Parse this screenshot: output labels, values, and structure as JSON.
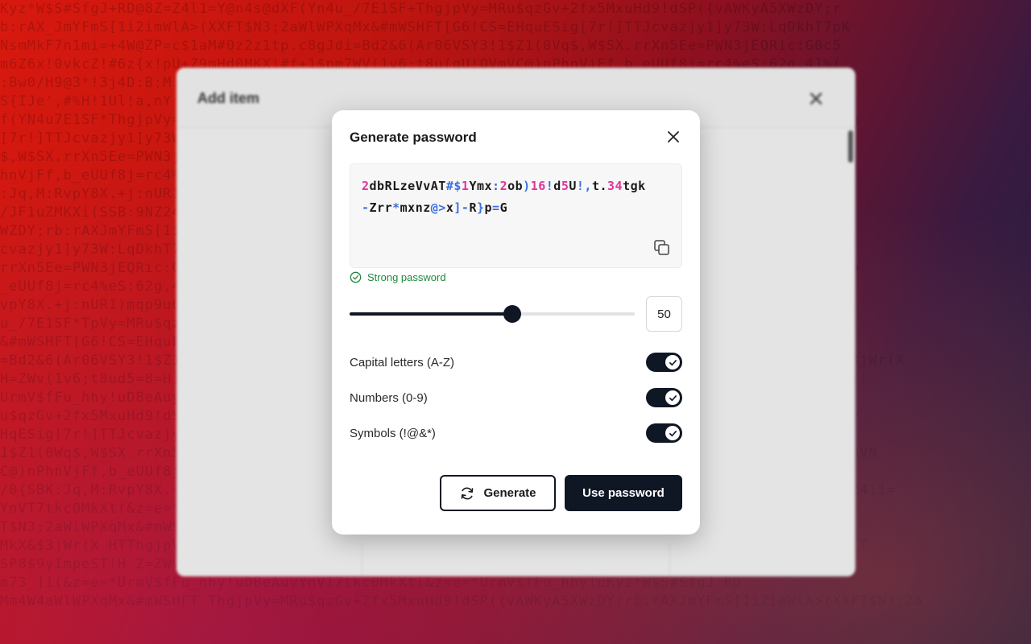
{
  "background": {
    "lines": [
      "Kyz*W$S#SfgJ+RD@8Z=Z4l1=Y@n4s@dXF(Yn4u_/7E1SF+ThgjpVy=MRu$qzGv+2fx5MxuHd9!dSP({vAWKyA5XWzDY;r",
      "b:rAX_JmYFmS[1i2imWlA>(XXFT$N3;2aWlWPXqMx&#mWSHFT[G6!CS=EHquESig[7r!]TTJcvazjy1]y73W:LqDkhT7pK",
      "NsmMkF7n1mi=+4W@ZP=c$1aM#0z2z1tp.c8gJdi=Bd2&6(Ar06VSY3!1$Z1(0Vq$,W$SX.rrXn5Ee=PWN3jEQRic:G0c5",
      "m6Z6x!0vkcZ!#6z{x!pU+Z9mHd0MKXi#f+1$pm7WV(1v6;t8u(qU!QVmVC@)nPhnVjFf,b_eUUf8j=rc4%eS:62g,4]%(",
      ":Bw0/H9@3*!3j4D:B;M.l,3x9;1Ay3:+XF!ST;W$1t(!zVu;XL!$7F5:b.9Q!!#j+B.)rsnUR1)mqp9u6&z*",
      "S{IJe',#%H!1Ul!a,nY:;2cuWOR=!p+P*M)(pU!:r$U:EnaM00p:9NZ24+WN3;L1=4!2&L6GA*TpVy=MRu$qzGv+",
      "f(YN4u7E1SF*ThgjpVy=MRu$qzGv+2fx5MxuHd9!dSP({vAWKyA5XWzDY;rb:rAXJmYFmS[1i2imWlA>[G6!CS=EHquESig",
      "[7r!]TTJcvazjy1]y73W:LqDkhT7pKNsmMkF7n1mi=+4W@ZP=c$1aM#0z2z1tp.c8gJdi=Bd2&6(Ar06VSY3!1$Z1(0Wq",
      "$,W$SX.rrXn5Ee=PWN3jEQRic:G0c5m6Z6x!0vkcZ!#6z{x!pU+Z9mHd0MKXi#f+1$pm7WV(1v6;t8ud5=8=H)oVNC@)nP",
      "hnVjFf,b_eUUf8j=rc4%eS:62g,4]%(:Bw0/H9@3*!3j4D:B;M.l,3x9;1Ay3:+XF!ST;W$1t(!zVu!U+Z9oe/0{SBK",
      ":Jq,M:RvpY8X.+j:nUR1)mqp9u6&z*S{IJe',#%H!1Ul!a,nY:;2cuWOR=!p+P*M)(pU!:r$U:EnaM0.khYfaB8+AUxrf&",
      "/JF1uZMKXi(SSB:9NZ24+WN3;L1=4!2&L6GA*TpVy=MRu$qzGv+2fx5MxuHd9!dSP({vAWKyA5XWu$qzGv+2fx5MxuM",
      "WZDY;rb:rAXJmYFmS[1i2imWlA>[G6!CS=EHquESig[7r!]TTJcvazjy1]y73W:LqDkhT7pKNsmMkF7HqESig[7r!]TTJ",
      "cvazjy1]y73W:LqDkhT7pKNsmMkF7n1mi=+4W@ZP=c$1aM#0z2z1tp.c8gJdi=Bd2&6(Ar06VSY3!1$Z1(0Wq$,W$SX.",
      "rrXn5Ee=PWN3jEQRic:G0c5m6Z6x!0vkcZ!#6z{x!pU+Z9mHd0MKXi#f+1$pm7WV(1v6;t8ud5=8=H)oVNC@)nPhnVjFf,b",
      "_eUUf8j=rc4%eS:62g,4]%(:Bw0/H9@3*!3j4D:B;M.l,3x9;1Ay3:+XF!ST;W$1t(!zVu!U+Z9oe/0{SBK:Jq,M:cR",
      "vpY8X.+j:nUR1)mqp9u6&z*S{IJe',#%H!1Ul!a,nY:;2cuWOR=!p+P*M)(pU!:r$U:EnaM0.khYfaB8+AUxrf(Yn4",
      "u_/7E1SF*TpVy=MRu$qzGv+2fx5MxuHd9!dSP({vAWKyA5XWzDY;rb:rAXJmYFmS[1i2imWlA>(XXFT$N3;2aWlWPXqMx",
      "&#mWSHFT[G6!CS=EHquESig[7r!]TTJcvazjy1]y73W:LqDkhT7pKNsmMkF7n1mi=+4W@ZP=c$1aM#0z2z1tp.c8gJdi",
      "=Bd2&6(Ar06VSY3!1$Z1(0Wq$,W$SX.rrXn5Ee=PWN3jEQRic:G0c5m6Z6x!0vkcZ!#6z{x!pU+Z9mHd0MKXi#f+1$pm3-3jWr(X",
      "H=ZWv(1v6;t8ud5=8=H)oVNC@)nPhnVjFf,b_eUUf8j=rc4%eS:62g,4]%(:Bw0/H9@3*!3j4D:B;M.l,3xSP8$9yImpeST!",
      "UrmV$fFu_hhy!uDBeAuyYnVT7tkc0MkXt(&z=e=*UrmV$fFu_hhy!uDBeAuyYnVT7tkc0MkXm73_]i(&z=e=*",
      "u$qzGv+2fx5MxuHd9!dSP({vAWKyA5XWzDY;rb:rAXJmYFmS[1i2imWlA>(XXFT$N3;2aWlWPXEjET*ThgjpVy=MRu$qzGv",
      "HqESig[7r!]TTJcvazjy1]y73W:LqDkhT7pKNsmMkF7n1mi=+4W@ZP=c$1aM#0z2z1tp.c8gJdi=BmWSHFT[G6!CS=",
      "1$Z1(0Wq$,W$SX.rrXn5Ee=PWN3jEQRic:G0c5m6Z6x!0vkcZ!#6z{x!pU+Z9mHd0MKXi#f+1$pm7WV(1v6;t8ud5=8=H)oVN",
      "C@)nPhnVjFf,b_eUUf8j=rc4%eS:62g,4]%(:Bw0/H9@3*!3j4D:B;M.l,3x9;1Ay3:+XF!ST;W$1t(!zVu!p+P*M)(pU",
      "/0{SBK:Jq,M:RvpY8X.+j:nUR1)mqp9u6&z*S{IJe',#%H!1Ul!a,nY:;2cuWOR=!p+P*M)(pU!:r$U:Ena.fgJ RD@8Z=Z4l1=",
      "YnVT7tkc0MkXt(&z=e=*UrmV$fFu_hhy!uDBeAuyYnVT7tkc0MkXm73_]i(&z=e=*UrmV$fFuS[1i2imWlA>(XXF",
      "T$N3;2aWlWPXqMx&#mWSHFT[G6!CS=EHquESig[7r!]TTJcvazjy1]y73W:LqDkhT7pKNsmMkF7n1mi=+4W@Z$R4e2=+",
      "MkX&$3jWr(X HTThgjpVy=MRu$qzGv+2fx5MxuHd9!dSP({vAWKyA5XWzDY;rb:rAXJmYFmS[1i2imWlA>(XXFT$N3;2aWlT",
      "SP8$9yImpeST!H Z=ZWv(1v6;t8ud5=8=H)oVNC@)nPhnVjFf,b_eUUf8j=rc4%eS:62g,4]%(:Bw0/H9%&H 1bMk2$3:",
      "m73_]i(&z=e=*UrmV$fFu_hhy!uDBeAuyYnVT7tkc0MkXt(&z=e=*UrmV$fFu_hhy!uKyz*W$S#SfgJ RD",
      "Mm4W4aWlWPXqMx&#mWSHFT ThgjpVy=MRu$qzGv+2fx5MxuHd9!dSP({vAWKyA5XWzDY;rb:rAXJmYFmS[1i2imWlA>(XXFT$N3;2a"
    ]
  },
  "underlying_modal": {
    "title": "Add item",
    "close_glyph": "✕"
  },
  "dialog": {
    "title": "Generate password",
    "password_segments": [
      {
        "t": "2",
        "k": "num"
      },
      {
        "t": "dbRLzeVvAT",
        "k": "let"
      },
      {
        "t": "#$",
        "k": "sym"
      },
      {
        "t": "1",
        "k": "num"
      },
      {
        "t": "Ymx",
        "k": "let"
      },
      {
        "t": ":",
        "k": "sym"
      },
      {
        "t": "2",
        "k": "num"
      },
      {
        "t": "ob",
        "k": "let"
      },
      {
        "t": ")",
        "k": "sym"
      },
      {
        "t": "16",
        "k": "num"
      },
      {
        "t": "!",
        "k": "sym"
      },
      {
        "t": "d",
        "k": "let"
      },
      {
        "t": "5",
        "k": "num"
      },
      {
        "t": "U",
        "k": "let"
      },
      {
        "t": "!,",
        "k": "sym"
      },
      {
        "t": "t.",
        "k": "let"
      },
      {
        "t": "34",
        "k": "num"
      },
      {
        "t": "tgk",
        "k": "let"
      },
      {
        "t": "-",
        "k": "sym"
      },
      {
        "t": "Zrr",
        "k": "let"
      },
      {
        "t": "*",
        "k": "sym"
      },
      {
        "t": "mxnz",
        "k": "let"
      },
      {
        "t": "@>",
        "k": "sym"
      },
      {
        "t": "x",
        "k": "let"
      },
      {
        "t": "]-",
        "k": "sym"
      },
      {
        "t": "R",
        "k": "let"
      },
      {
        "t": "}",
        "k": "sym"
      },
      {
        "t": "p",
        "k": "let"
      },
      {
        "t": "=",
        "k": "sym"
      },
      {
        "t": "G",
        "k": "let"
      }
    ],
    "strength_label": "Strong password",
    "length": {
      "value": "50",
      "fraction": 0.57
    },
    "options": [
      {
        "label": "Capital letters (A-Z)",
        "enabled": true
      },
      {
        "label": "Numbers (0-9)",
        "enabled": true
      },
      {
        "label": "Symbols (!@&*)",
        "enabled": true
      }
    ],
    "buttons": {
      "generate_label": "Generate",
      "use_label": "Use password"
    },
    "icons": {
      "close": "close-icon",
      "copy": "copy-icon",
      "check_circle": "check-circle-icon",
      "refresh": "refresh-icon",
      "check": "check-icon"
    },
    "colors": {
      "primary": "#0f1724",
      "number": "#e0359b",
      "symbol": "#3b6fe0",
      "success": "#1f8a3c"
    }
  }
}
